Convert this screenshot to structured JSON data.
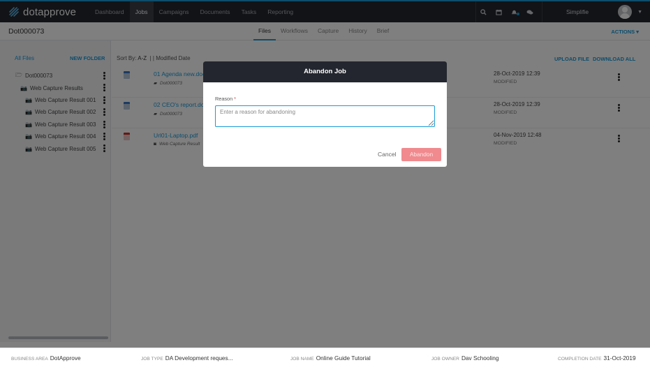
{
  "app": {
    "logo_text": "dotapprove",
    "nav": [
      "Dashboard",
      "Jobs",
      "Campaigns",
      "Documents",
      "Tasks",
      "Reporting"
    ],
    "active_nav": "Jobs",
    "user_name": "Simplifie",
    "icons": [
      "search-icon",
      "calendar-icon",
      "bell-icon",
      "chat-icon"
    ],
    "accent_color": "#1a9ad6"
  },
  "subheader": {
    "job_id": "Dot000073",
    "tabs": [
      "Files",
      "Workflows",
      "Capture",
      "History",
      "Brief"
    ],
    "active_tab": "Files",
    "actions_label": "ACTIONS"
  },
  "sidebar": {
    "all_files": "All Files",
    "new_folder": "NEW FOLDER",
    "tree": [
      {
        "label": "Dot000073",
        "icon": "folder-open-icon",
        "indent": 0
      },
      {
        "label": "Web Capture Results",
        "icon": "camera-icon",
        "indent": 1
      },
      {
        "label": "Web Capture Result 001",
        "icon": "camera-icon",
        "indent": 2
      },
      {
        "label": "Web Capture Result 002",
        "icon": "camera-icon",
        "indent": 2
      },
      {
        "label": "Web Capture Result 003",
        "icon": "camera-icon",
        "indent": 2
      },
      {
        "label": "Web Capture Result 004",
        "icon": "camera-icon",
        "indent": 2
      },
      {
        "label": "Web Capture Result 005",
        "icon": "camera-icon",
        "indent": 2
      }
    ]
  },
  "main": {
    "sort_label": "Sort By:",
    "sort_az": "A-Z",
    "sort_sep": "|",
    "sort_modified": "| Modified Date",
    "upload_file": "UPLOAD FILE",
    "download_all": "DOWNLOAD ALL",
    "files": [
      {
        "name": "01 Agenda new.doc",
        "location": "Dot000073",
        "date": "28-Oct-2019 12:39",
        "status": "MODIFIED",
        "type": "doc"
      },
      {
        "name": "02 CEO's report.doc",
        "location": "Dot000073",
        "date": "28-Oct-2019 12:39",
        "status": "MODIFIED",
        "type": "doc"
      },
      {
        "name": "Url01-Laptop.pdf",
        "location": "Web Capture Result",
        "date": "04-Nov-2019 12:48",
        "status": "MODIFIED",
        "type": "pdf"
      }
    ]
  },
  "footer": {
    "business_area_key": "BUSINESS AREA",
    "business_area": "DotApprove",
    "job_type_key": "JOB TYPE",
    "job_type": "DA Development reques...",
    "job_name_key": "JOB NAME",
    "job_name": "Online Guide Tutorial",
    "job_owner_key": "JOB OWNER",
    "job_owner": "Dav Schooling",
    "completion_key": "COMPLETION DATE",
    "completion_date": "31-Oct-2019"
  },
  "modal": {
    "title": "Abandon Job",
    "reason_label": "Reason",
    "required_mark": "*",
    "reason_value": "",
    "reason_placeholder": "Enter a reason for abandoning",
    "cancel_label": "Cancel",
    "abandon_label": "Abandon",
    "abandon_color": "#f08a8e"
  }
}
